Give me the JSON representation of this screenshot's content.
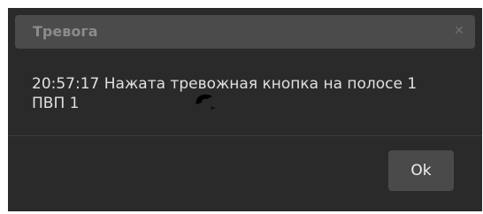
{
  "dialog": {
    "title": "Тревога",
    "close_icon": "close-icon",
    "message": "20:57:17 Нажата тревожная кнопка на полосе 1 ПВП 1",
    "ok_label": "Ok"
  },
  "colors": {
    "dialog_background": "#2a2a2a",
    "titlebar_background": "#4b4b4b",
    "title_text": "#8b8b8b",
    "message_text": "#e0e0e0",
    "button_background": "#4a4a4a"
  }
}
